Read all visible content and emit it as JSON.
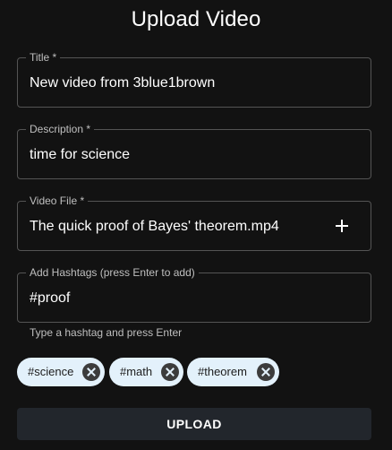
{
  "page": {
    "title": "Upload Video"
  },
  "form": {
    "title_field": {
      "label": "Title *",
      "value": "New video from 3blue1brown"
    },
    "description_field": {
      "label": "Description *",
      "value": "time for science"
    },
    "video_file_field": {
      "label": "Video File *",
      "value": "The quick proof of Bayes' theorem.mp4",
      "add_icon": "plus-icon"
    },
    "hashtag_field": {
      "label": "Add Hashtags (press Enter to add)",
      "value": "#proof",
      "helper": "Type a hashtag and press Enter"
    },
    "hashtags": [
      {
        "label": "#science",
        "delete_icon": "cancel-circle-icon"
      },
      {
        "label": "#math",
        "delete_icon": "cancel-circle-icon"
      },
      {
        "label": "#theorem",
        "delete_icon": "cancel-circle-icon"
      }
    ],
    "upload_label": "UPLOAD"
  },
  "colors": {
    "background": "#121212",
    "chip_background": "#e3f1fb",
    "chip_text": "#1c1c1c",
    "button_background": "#22262c"
  }
}
